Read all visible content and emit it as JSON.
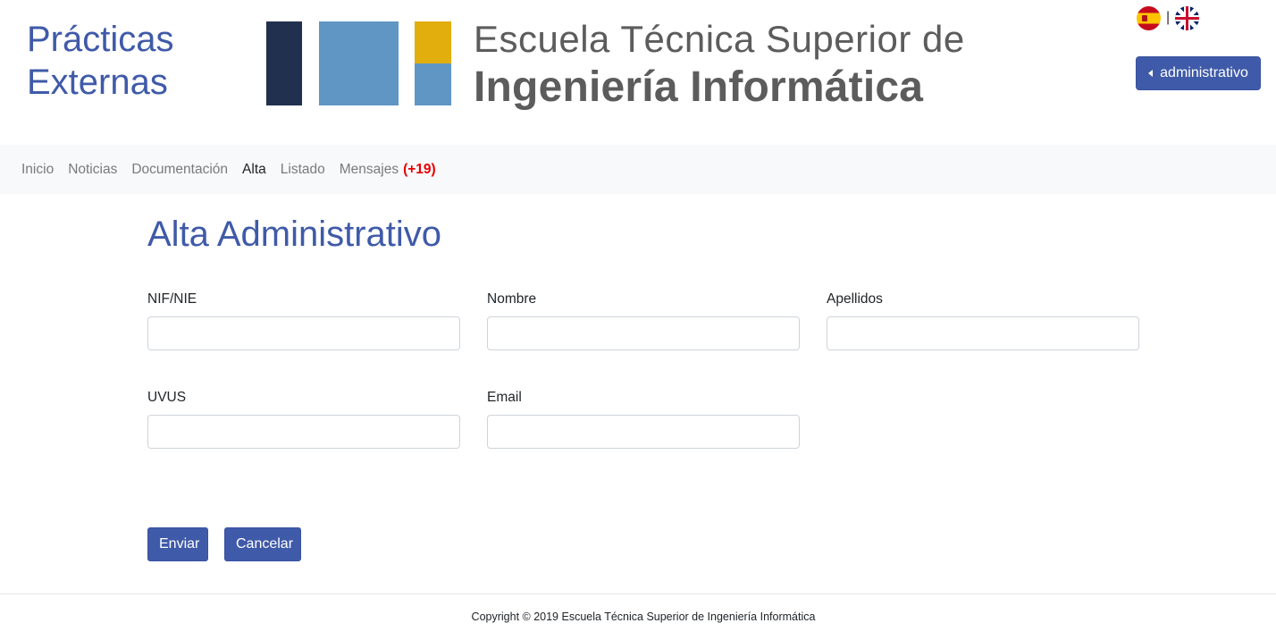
{
  "header": {
    "site_title_line1": "Prácticas",
    "site_title_line2": "Externas",
    "logo_line1": "Escuela Técnica Superior de",
    "logo_line2": "Ingeniería Informática",
    "lang_separator": "|",
    "user_button_label": "administrativo"
  },
  "nav": {
    "items": [
      {
        "label": "Inicio"
      },
      {
        "label": "Noticias"
      },
      {
        "label": "Documentación"
      },
      {
        "label": "Alta"
      },
      {
        "label": "Listado"
      },
      {
        "label": "Mensajes"
      }
    ],
    "messages_badge": "(+19)",
    "active": "Alta"
  },
  "main": {
    "title": "Alta Administrativo",
    "fields": {
      "nif": {
        "label": "NIF/NIE",
        "value": ""
      },
      "nombre": {
        "label": "Nombre",
        "value": ""
      },
      "apellidos": {
        "label": "Apellidos",
        "value": ""
      },
      "uvus": {
        "label": "UVUS",
        "value": ""
      },
      "email": {
        "label": "Email",
        "value": ""
      }
    },
    "submit_label": "Enviar",
    "cancel_label": "Cancelar"
  },
  "footer": {
    "copyright": "Copyright © 2019 Escuela Técnica Superior de Ingeniería Informática"
  },
  "colors": {
    "brand_blue": "#3f5aa8",
    "logo_navy": "#22304f",
    "logo_light_blue": "#6096c3",
    "logo_gold": "#e2ae0d",
    "badge_red": "#e60000"
  }
}
